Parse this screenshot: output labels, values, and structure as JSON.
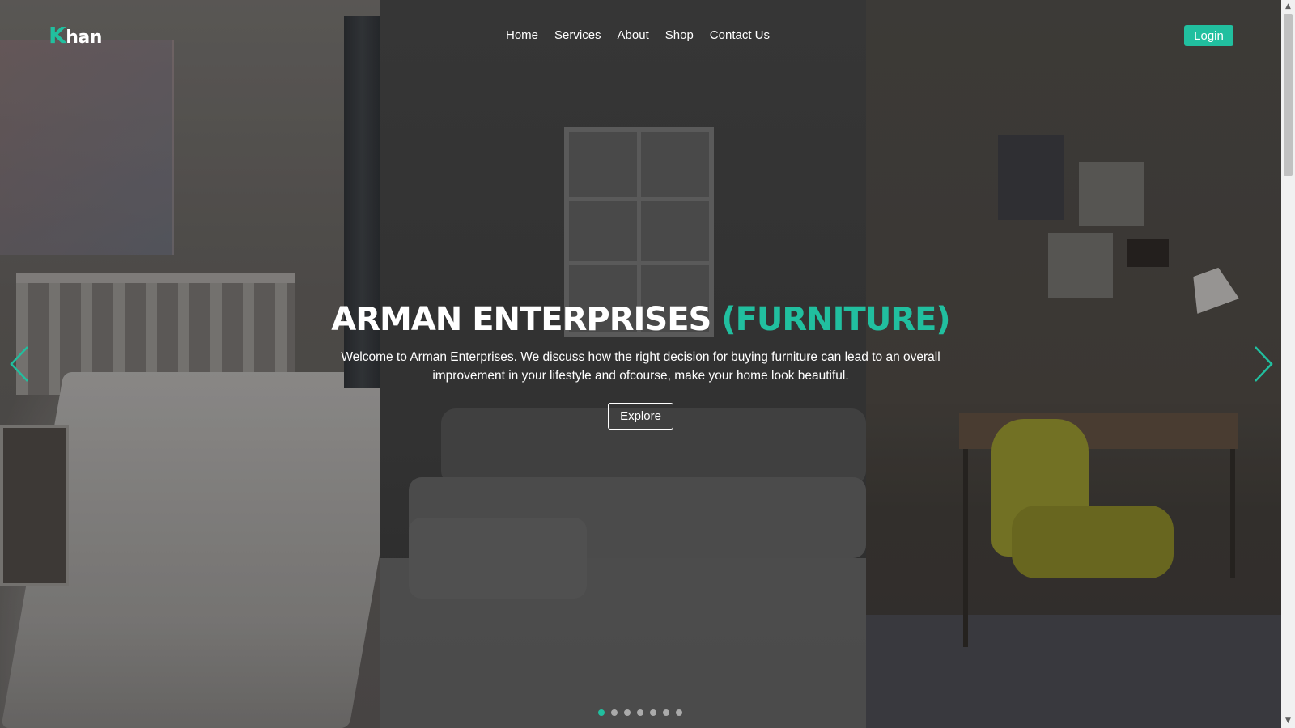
{
  "brand": {
    "logo_initial": "K",
    "logo_rest": "han",
    "accent_color": "#21bf9f"
  },
  "nav": {
    "items": [
      {
        "label": "Home"
      },
      {
        "label": "Services"
      },
      {
        "label": "About"
      },
      {
        "label": "Shop"
      },
      {
        "label": "Contact Us"
      }
    ],
    "login_label": "Login"
  },
  "hero": {
    "title_main": "ARMAN ENTERPRISES",
    "title_accent": "(FURNITURE)",
    "description": "Welcome to Arman Enterprises. We discuss how the right decision for buying furniture can lead to an overall improvement in your lifestyle and ofcourse, make your home look beautiful.",
    "explore_label": "Explore"
  },
  "carousel": {
    "prev_icon": "chevron-left-icon",
    "next_icon": "chevron-right-icon",
    "slide_count": 7,
    "active_index": 0
  },
  "scrollbar": {
    "up_icon": "scroll-up-arrow-icon",
    "down_icon": "scroll-down-arrow-icon"
  }
}
